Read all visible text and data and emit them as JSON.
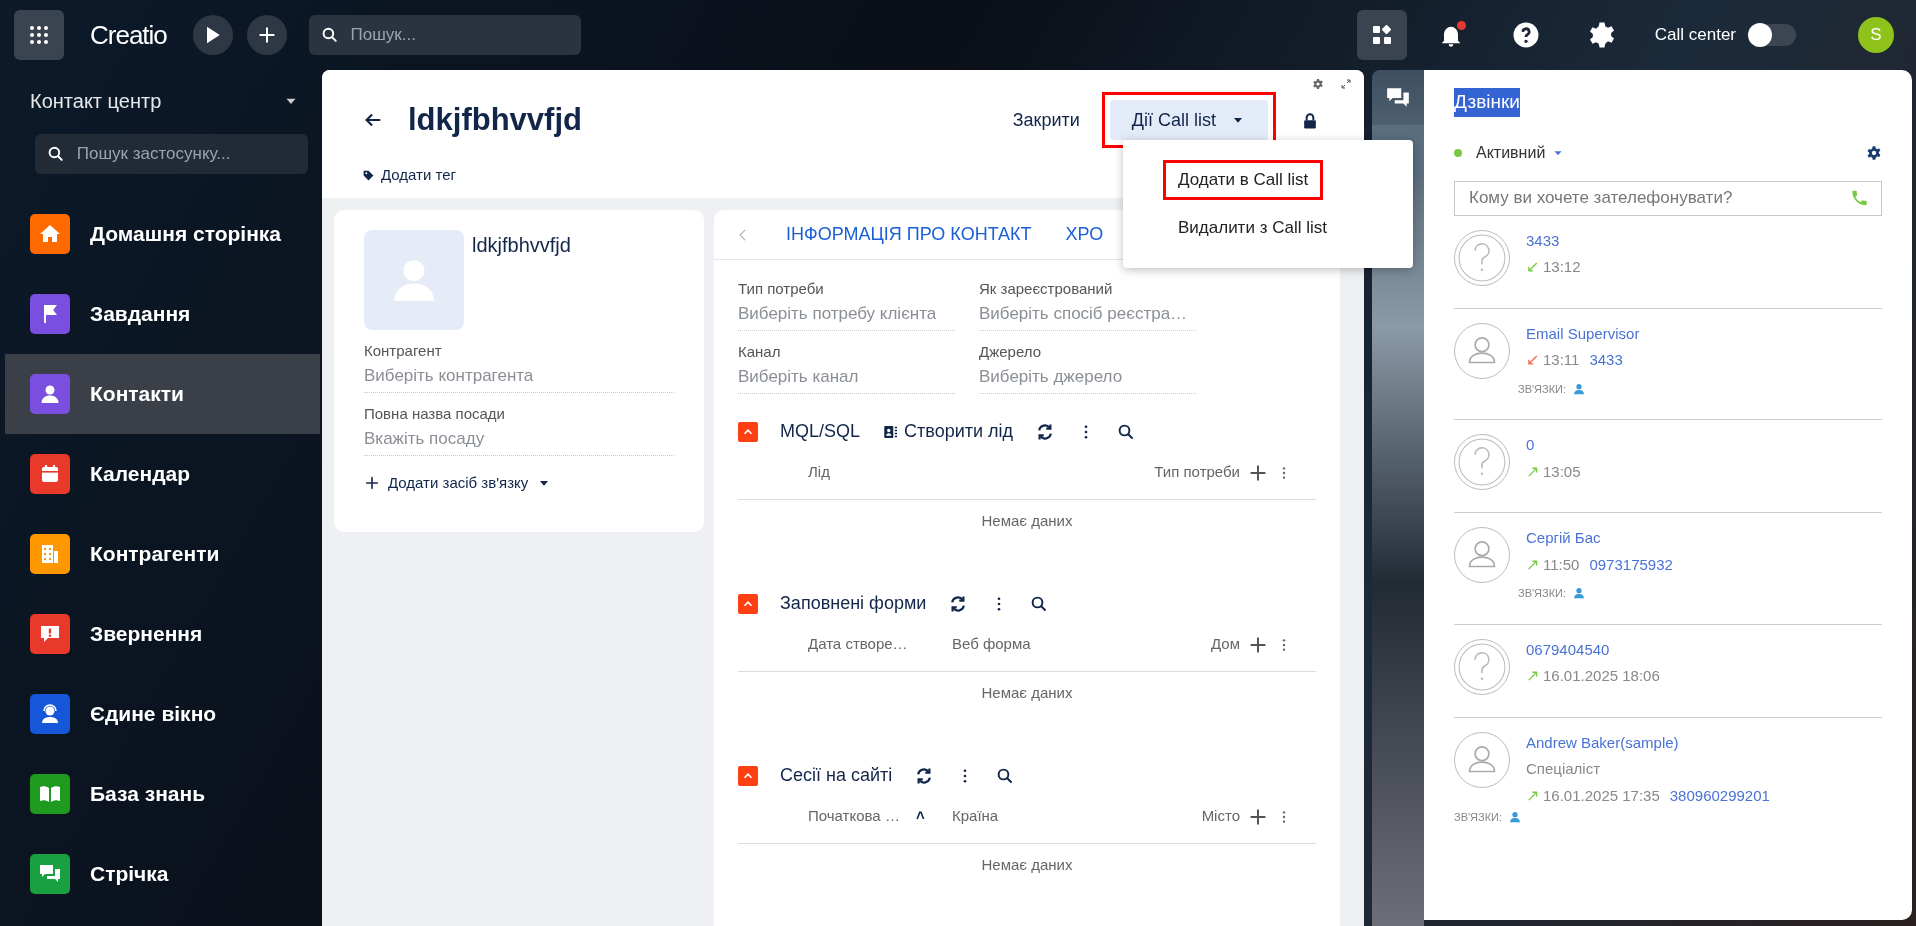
{
  "topbar": {
    "logo": "Creatio",
    "search_placeholder": "Пошук...",
    "notification_dot": true,
    "call_center_label": "Call center",
    "call_center_on": false,
    "avatar": "S"
  },
  "sidebar": {
    "title": "Контакт центр",
    "search_placeholder": "Пошук застосунку...",
    "items": [
      {
        "label": "Домашня сторінка",
        "kind": "home",
        "color": "#ff6a00",
        "selected": false
      },
      {
        "label": "Завдання",
        "kind": "flag",
        "color": "#7a4fe0",
        "selected": false
      },
      {
        "label": "Контакти",
        "kind": "person",
        "color": "#7a4fe0",
        "selected": true
      },
      {
        "label": "Календар",
        "kind": "calendar",
        "color": "#e8392a",
        "selected": false
      },
      {
        "label": "Контрагенти",
        "kind": "building",
        "color": "#ff9800",
        "selected": false
      },
      {
        "label": "Звернення",
        "kind": "alert",
        "color": "#e8392a",
        "selected": false
      },
      {
        "label": "Єдине вікно",
        "kind": "agent",
        "color": "#1656d9",
        "selected": false
      },
      {
        "label": "База знань",
        "kind": "book",
        "color": "#1e9a1e",
        "selected": false
      },
      {
        "label": "Стрічка",
        "kind": "chat",
        "color": "#19a040",
        "selected": false
      }
    ]
  },
  "record": {
    "title": "ldkjfbhvvfjd",
    "add_tag": "Додати тег",
    "close_label": "Закрити",
    "actions_label": "Дії Call list",
    "actions_highlighted": true,
    "menu": [
      {
        "label": "Додати в Call list",
        "highlighted": true
      },
      {
        "label": "Видалити з Call list",
        "highlighted": false
      }
    ]
  },
  "profile": {
    "name": "ldkjfbhvvfjd",
    "fields": [
      {
        "label": "Контрагент",
        "placeholder": "Виберіть контрагента"
      },
      {
        "label": "Повна назва посади",
        "placeholder": "Вкажіть посаду"
      }
    ],
    "add_contact": "Додати засіб зв'язку"
  },
  "tabs": [
    {
      "label": "ІНФОРМАЦІЯ ПРО КОНТАКТ"
    },
    {
      "label": "ХРО"
    }
  ],
  "info_fields": [
    {
      "label": "Тип потреби",
      "placeholder": "Виберіть потребу клієнта"
    },
    {
      "label": "Як зареєстрований",
      "placeholder": "Виберіть спосіб реєстра…"
    },
    {
      "label": "Канал",
      "placeholder": "Виберіть канал"
    },
    {
      "label": "Джерело",
      "placeholder": "Виберіть джерело"
    }
  ],
  "sections": [
    {
      "title": "MQL/SQL",
      "create_label": "Створити лід",
      "columns": [
        {
          "label": "Лід"
        },
        {
          "label": "Тип потреби"
        }
      ],
      "empty": "Немає даних"
    },
    {
      "title": "Заповнені форми",
      "columns": [
        {
          "label": "Дата створе…"
        },
        {
          "label": "Веб форма"
        },
        {
          "label": "Дом"
        }
      ],
      "empty": "Немає даних"
    },
    {
      "title": "Сесії на сайті",
      "columns": [
        {
          "label": "Початкова …",
          "sort": "˄"
        },
        {
          "label": "Країна"
        },
        {
          "label": "Місто"
        }
      ],
      "empty": "Немає даних"
    }
  ],
  "calls_panel": {
    "title": "Дзвінки",
    "title_selected": true,
    "status": {
      "label": "Активний",
      "color": "#7ac943"
    },
    "search_placeholder": "Кому ви хочете зателефонувати?",
    "calls": [
      {
        "kind": "unknown",
        "name": "3433",
        "direction": "↙",
        "missed": false,
        "time": "13:12"
      },
      {
        "kind": "contact",
        "name": "Email Supervisor",
        "direction": "↙",
        "missed": true,
        "time": "13:11",
        "number": "3433",
        "links_label": "ЗВ'ЯЗКИ:"
      },
      {
        "kind": "unknown",
        "name": "0",
        "direction": "↗",
        "missed": false,
        "time": "13:05"
      },
      {
        "kind": "contact",
        "name": "Сергій Бас",
        "direction": "↗",
        "missed": false,
        "time": "11:50",
        "number": "0973175932",
        "links_label": "ЗВ'ЯЗКИ:"
      },
      {
        "kind": "unknown",
        "name": "0679404540",
        "direction": "↗",
        "missed": false,
        "time": "16.01.2025 18:06"
      },
      {
        "kind": "contact",
        "name": "Andrew Baker(sample)",
        "position": "Спеціаліст",
        "direction": "↗",
        "missed": false,
        "time": "16.01.2025 17:35",
        "number": "380960299201",
        "links_label": "ЗВ'ЯЗКИ:"
      }
    ]
  }
}
